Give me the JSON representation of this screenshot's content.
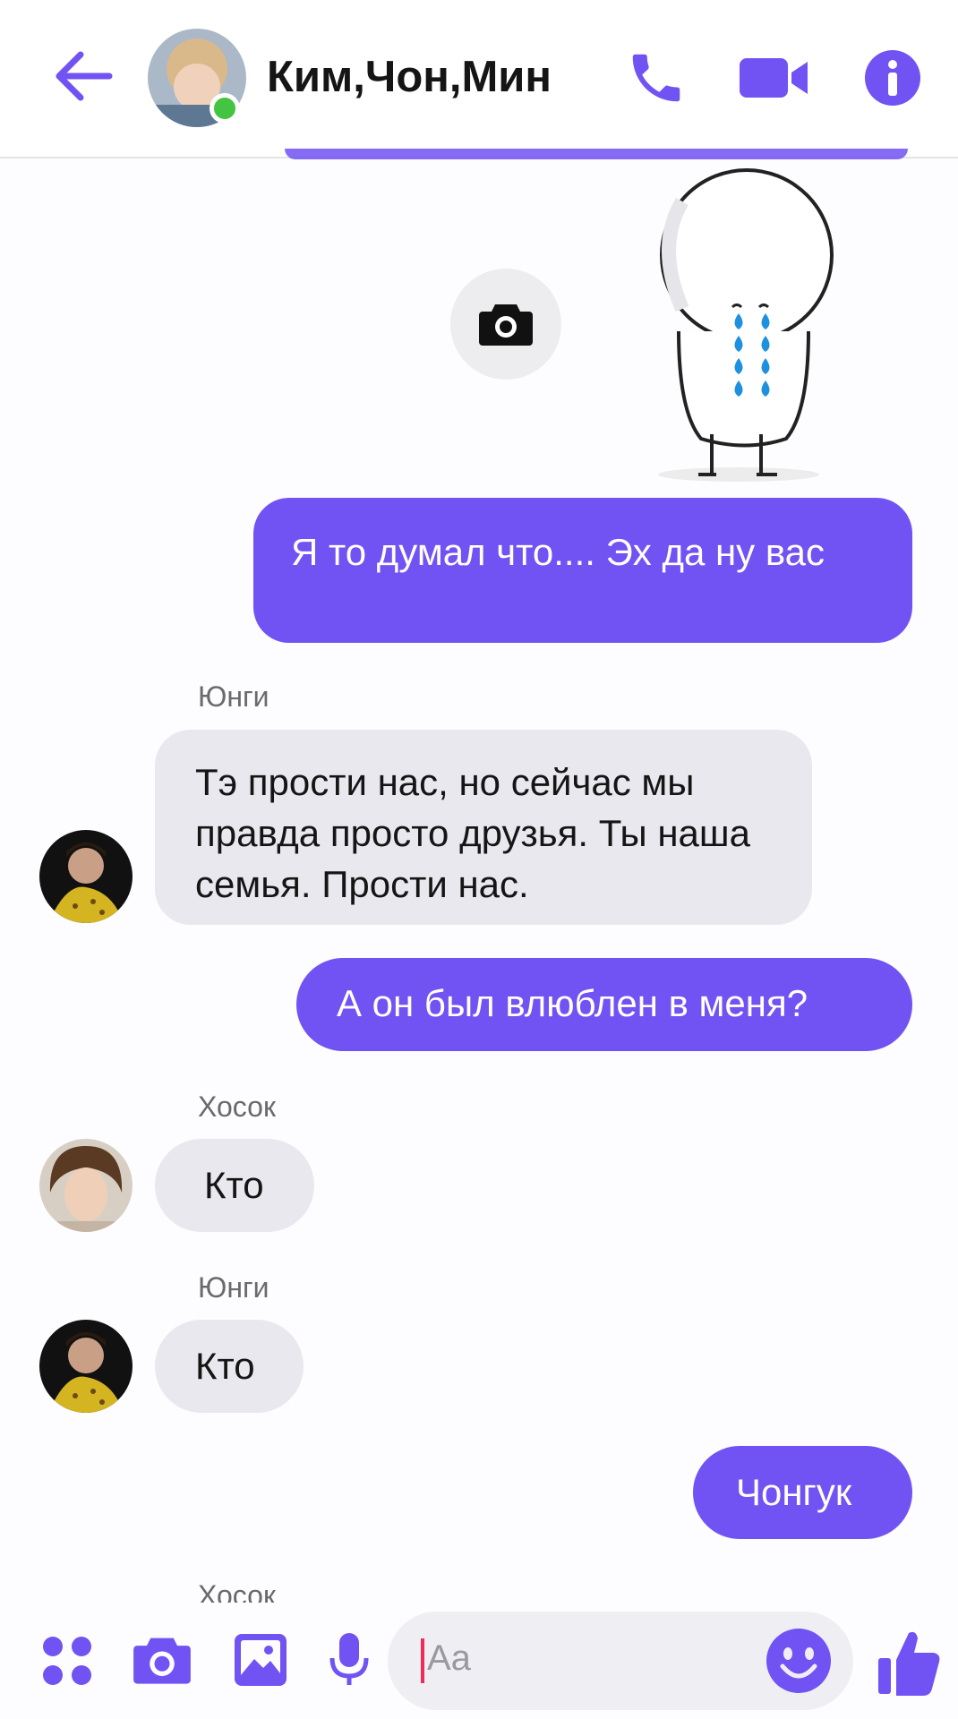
{
  "header": {
    "title": "Ким,Чон,Мин"
  },
  "theme": {
    "accent": "#7152f3",
    "incoming_bubble": "#e9e8ee",
    "online": "#44c541"
  },
  "messages": [
    {
      "type": "outgoing",
      "text": "Я то думал что.... Эх да ну вас"
    },
    {
      "type": "incoming",
      "sender": "Юнги",
      "text": "Тэ прости нас, но сейчас мы правда просто друзья. Ты наша семья. Прости нас."
    },
    {
      "type": "outgoing",
      "text": "А он был влюблен в меня?"
    },
    {
      "type": "incoming",
      "sender": "Хосок",
      "text": "Кто"
    },
    {
      "type": "incoming",
      "sender": "Юнги",
      "text": "Кто"
    },
    {
      "type": "outgoing",
      "text": "Чонгук"
    },
    {
      "type": "sender_partial",
      "sender": "Хосок"
    }
  ],
  "composer": {
    "placeholder": "Aa"
  },
  "icons": {
    "header": [
      "back-arrow-icon",
      "phone-icon",
      "video-camera-icon",
      "info-icon"
    ],
    "composer": [
      "apps-grid-icon",
      "camera-icon",
      "image-gallery-icon",
      "microphone-icon",
      "emoji-icon",
      "thumbs-up-icon"
    ]
  }
}
